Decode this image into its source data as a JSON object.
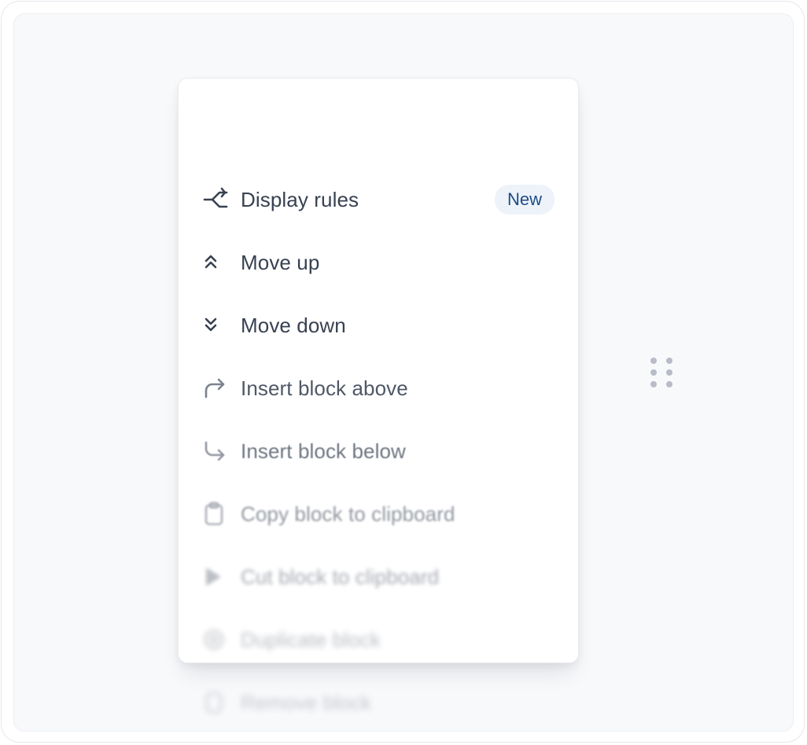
{
  "menu": {
    "items": [
      {
        "label": "Display rules",
        "icon": "branch-icon",
        "badge": "New"
      },
      {
        "label": "Move up",
        "icon": "chevrons-up-icon"
      },
      {
        "label": "Move down",
        "icon": "chevrons-down-icon"
      },
      {
        "label": "Insert block above",
        "icon": "corner-up-right-icon"
      },
      {
        "label": "Insert block below",
        "icon": "corner-down-right-icon"
      },
      {
        "label": "Copy block to clipboard",
        "icon": "clipboard-icon"
      },
      {
        "label": "Cut block to clipboard",
        "icon": "scissors-icon"
      },
      {
        "label": "Duplicate block",
        "icon": "duplicate-icon"
      },
      {
        "label": "Remove block",
        "icon": "trash-icon"
      }
    ]
  },
  "drag_handle": {
    "icon": "drag-dots-icon"
  },
  "colors": {
    "text": "#374151",
    "badge_bg": "#eef3fa",
    "badge_text": "#1e4c86",
    "frame_bg": "#f8f9fb"
  }
}
